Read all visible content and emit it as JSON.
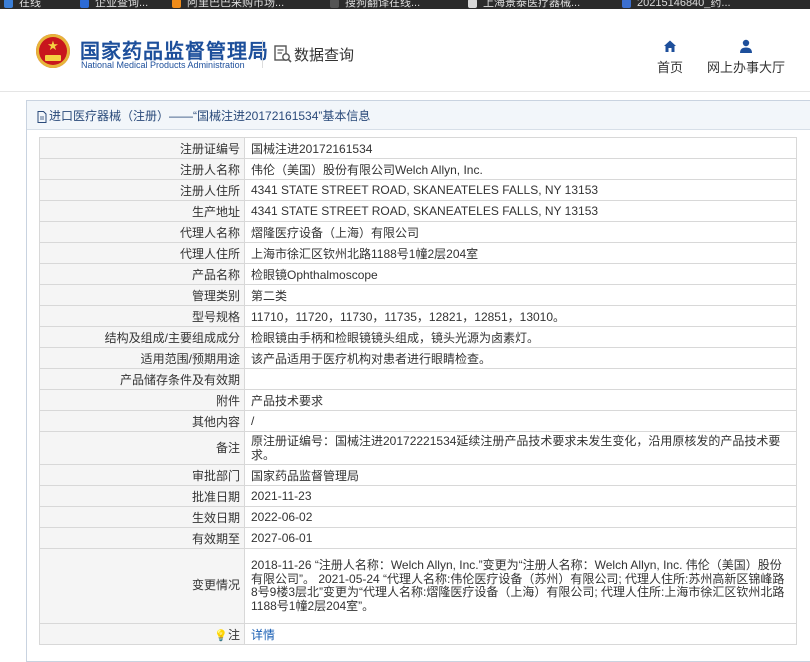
{
  "bookmarks": [
    {
      "label": "在线",
      "color": "#3b7fd8"
    },
    {
      "label": "企业查询...",
      "color": "#2d6bd6"
    },
    {
      "label": "阿里巴巴采购市场...",
      "color": "#f08c1a"
    },
    {
      "label": "搜狗翻译在线...",
      "color": "#333333"
    },
    {
      "label": "上海景泰医疗器械...",
      "color": "#d9d9d9"
    },
    {
      "label": "20215146840_药...",
      "color": "#3b6fd0"
    }
  ],
  "header": {
    "title": "国家药品监督管理局",
    "subtitle": "National Medical Products Administration",
    "query_label": "数据查询",
    "nav_home": "首页",
    "nav_hall": "网上办事大厅",
    "brand_color": "#1d4f9b"
  },
  "panel": {
    "title": "进口医疗器械（注册）——“国械注进20172161534”基本信息"
  },
  "rows": [
    {
      "key": "注册证编号",
      "value": "国械注进20172161534"
    },
    {
      "key": "注册人名称",
      "value": "伟伦（美国）股份有限公司Welch Allyn, Inc."
    },
    {
      "key": "注册人住所",
      "value": "4341 STATE STREET ROAD, SKANEATELES FALLS, NY 13153"
    },
    {
      "key": "生产地址",
      "value": "4341 STATE STREET ROAD, SKANEATELES FALLS, NY 13153"
    },
    {
      "key": "代理人名称",
      "value": "熠隆医疗设备（上海）有限公司"
    },
    {
      "key": "代理人住所",
      "value": "上海市徐汇区钦州北路1188号1幢2层204室"
    },
    {
      "key": "产品名称",
      "value": "检眼镜Ophthalmoscope"
    },
    {
      "key": "管理类别",
      "value": "第二类"
    },
    {
      "key": "型号规格",
      "value": "11710，11720，11730，11735，12821，12851，13010。"
    },
    {
      "key": "结构及组成/主要组成成分",
      "value": "检眼镜由手柄和检眼镜镜头组成，镜头光源为卤素灯。"
    },
    {
      "key": "适用范围/预期用途",
      "value": "该产品适用于医疗机构对患者进行眼睛检查。"
    },
    {
      "key": "产品储存条件及有效期",
      "value": ""
    },
    {
      "key": "附件",
      "value": "产品技术要求"
    },
    {
      "key": "其他内容",
      "value": "/"
    },
    {
      "key": "备注",
      "value": "原注册证编号：国械注进20172221534延续注册产品技术要求未发生变化，沿用原核发的产品技术要求。"
    },
    {
      "key": "审批部门",
      "value": "国家药品监督管理局"
    },
    {
      "key": "批准日期",
      "value": "2021-11-23"
    },
    {
      "key": "生效日期",
      "value": "2022-06-02"
    },
    {
      "key": "有效期至",
      "value": "2027-06-01"
    },
    {
      "key": "变更情况",
      "value": "2018-11-26 “注册人名称：Welch Allyn, Inc.”变更为“注册人名称：Welch Allyn, Inc. 伟伦（美国）股份有限公司”。 2021-05-24 “代理人名称:伟伦医疗设备（苏州）有限公司; 代理人住所:苏州高新区锦峰路8号9楼3层北”变更为“代理人名称:熠隆医疗设备（上海）有限公司; 代理人住所:上海市徐汇区钦州北路1188号1幢2层204室”。"
    },
    {
      "key": "注",
      "value": "详情"
    }
  ]
}
